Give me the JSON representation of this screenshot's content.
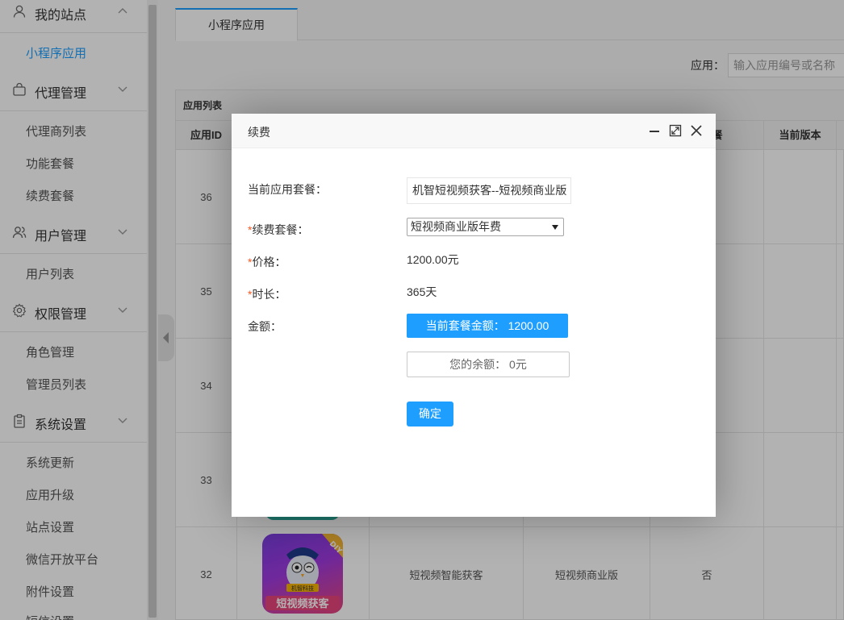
{
  "sidebar": {
    "groups": [
      {
        "title": "我的站点",
        "icon": "user-icon",
        "items": [
          "小程序应用"
        ]
      },
      {
        "title": "代理管理",
        "icon": "bag-icon",
        "items": [
          "代理商列表",
          "功能套餐",
          "续费套餐"
        ]
      },
      {
        "title": "用户管理",
        "icon": "users-icon",
        "items": [
          "用户列表"
        ]
      },
      {
        "title": "权限管理",
        "icon": "gear-icon",
        "items": [
          "角色管理",
          "管理员列表"
        ]
      },
      {
        "title": "系统设置",
        "icon": "clipboard-icon",
        "items": [
          "系统更新",
          "应用升级",
          "站点设置",
          "微信开放平台",
          "附件设置",
          "短信设置"
        ]
      }
    ],
    "active_item": "小程序应用"
  },
  "tabs": {
    "active": "小程序应用"
  },
  "filter": {
    "label": "应用：",
    "placeholder": "输入应用编号或名称"
  },
  "table": {
    "caption": "应用列表",
    "headers": [
      "应用ID",
      "",
      "",
      "",
      "检套餐",
      "当前版本"
    ],
    "rows": [
      {
        "id": "36",
        "name": "",
        "plan": "",
        "trial": ""
      },
      {
        "id": "35",
        "name": "",
        "plan": "",
        "trial": ""
      },
      {
        "id": "34",
        "name": "",
        "plan": "",
        "trial": ""
      },
      {
        "id": "33",
        "name": "",
        "plan": "",
        "trial": ""
      },
      {
        "id": "32",
        "name": "短视频智能获客",
        "plan": "短视频商业版",
        "trial": "否"
      }
    ],
    "logo_text": {
      "brand": "机智科技",
      "subtitle": "短视频获客",
      "badge": "DIY"
    }
  },
  "dialog": {
    "title": "续费",
    "labels": {
      "current_plan": "当前应用套餐：",
      "renew_plan": "续费套餐：",
      "price": "价格：",
      "duration": "时长：",
      "amount": "金额："
    },
    "required_mark": "*",
    "current_plan_value": "机智短视频获客--短视频商业版",
    "renew_plan_value": "短视频商业版年费",
    "price_value": "1200.00元",
    "duration_value": "365天",
    "amount_button": "当前套餐金额： 1200.00",
    "balance": "您的余额： 0元",
    "confirm": "确定"
  }
}
